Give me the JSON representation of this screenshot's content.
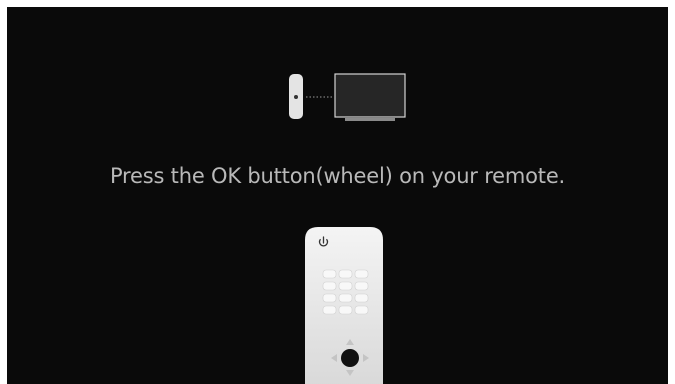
{
  "instruction": {
    "text": "Press the OK button(wheel) on your remote."
  },
  "colors": {
    "background": "#0a0a0a",
    "text": "#b9b9b9",
    "remote_body": "#ececec",
    "wheel": "#111111"
  },
  "icons": {
    "pairing": "remote-to-tv-icon",
    "remote": "magic-remote-icon",
    "power": "power-icon",
    "ok_wheel": "ok-wheel-icon"
  }
}
